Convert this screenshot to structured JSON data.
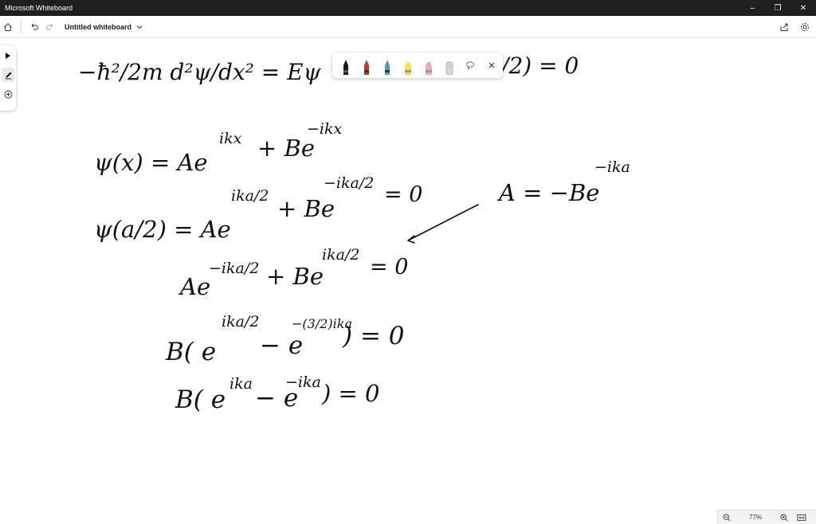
{
  "window": {
    "app_title": "Microsoft Whiteboard",
    "controls": {
      "minimize": "–",
      "restore": "❐",
      "close": "✕"
    }
  },
  "appbar": {
    "board_title": "Untitled whiteboard",
    "icons": [
      "home-icon",
      "undo-icon",
      "redo-icon",
      "chevron-down-icon",
      "share-icon",
      "settings-icon"
    ]
  },
  "left_toolbar": {
    "tools": [
      "select-pointer-icon",
      "inking-pen-icon",
      "add-icon"
    ],
    "active_tool": "inking-pen-icon"
  },
  "pen_tray": {
    "pens": [
      {
        "name": "black-pen",
        "color": "#1a1a1a"
      },
      {
        "name": "red-pen",
        "color": "#d32f2f"
      },
      {
        "name": "teal-pen",
        "color": "#4aa3b5"
      },
      {
        "name": "yellow-highlighter",
        "color": "#f5e43a"
      },
      {
        "name": "pink-highlighter",
        "color": "#f2a7b8"
      },
      {
        "name": "eraser",
        "color": "#d9d9d9"
      }
    ],
    "icons": [
      "lasso-select-icon",
      "close-icon"
    ]
  },
  "ink": {
    "eq1_lhs": "−ħ²/2m  d²ψ/dx² = Eψ",
    "eq1_rhs": "ψ(−a/2) = 0",
    "eq2_psi": "ψ(x) = Ae",
    "eq2_exp1": "ikx",
    "eq2_b": "+ Be",
    "eq2_exp2": "−ikx",
    "eq3_psi": "ψ(a/2) = Ae",
    "eq3_exp1": "ika/2",
    "eq3_b": "+ Be",
    "eq3_exp2": "−ika/2",
    "eq3_zero": "= 0",
    "eq4_a": "Ae",
    "eq4_exp1": "−ika/2",
    "eq4_b": "+ Be",
    "eq4_exp2": "ika/2",
    "eq4_zero": "= 0",
    "eq5_b": "B( e",
    "eq5_exp1": "ika/2",
    "eq5_minus": "− e",
    "eq5_exp2": "−(3/2)ika",
    "eq5_close": ") = 0",
    "eq6_b": "B( e",
    "eq6_exp1": "ika",
    "eq6_minus": "− e",
    "eq6_exp2": "−ika",
    "eq6_close": ") = 0",
    "side_a": "A = −Be",
    "side_exp": "−ika"
  },
  "zoom": {
    "level": "77%",
    "icons": [
      "zoom-out-icon",
      "zoom-in-icon",
      "fit-to-screen-icon"
    ]
  }
}
